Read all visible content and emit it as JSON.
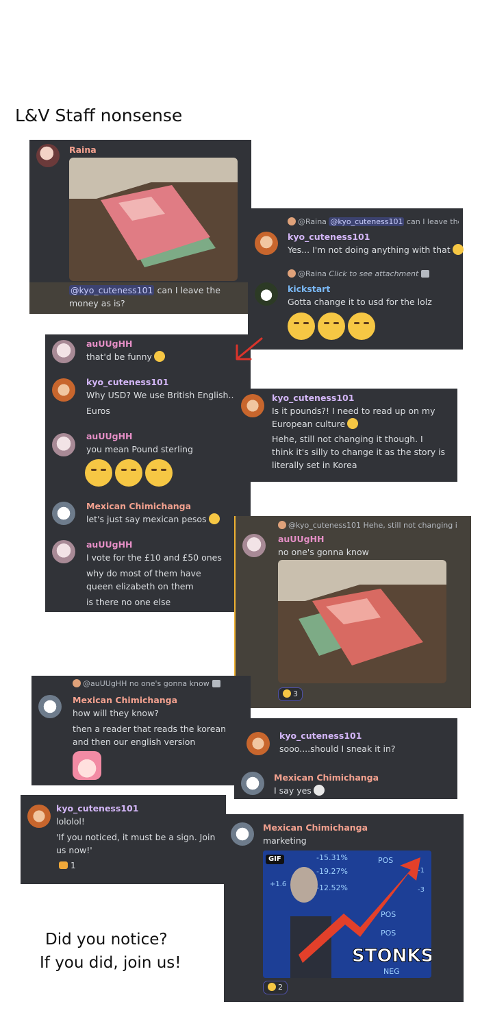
{
  "page": {
    "title": "L&V Staff nonsense",
    "closing_line_1": "Did you notice?",
    "closing_line_2": "If you did, join us!"
  },
  "colors": {
    "panel": "#313338",
    "highlight": "#45413a",
    "mention": "#3c4270",
    "accent_arrow": "#d9342b"
  },
  "card1": {
    "name": "Raina",
    "mention": "@kyo_cuteness101",
    "text": " can I leave the money as is?"
  },
  "card2": {
    "reply1_name": "@Raina",
    "reply1_mention": "@kyo_cuteness101",
    "reply1_text": " can I leave the m",
    "name1": "kyo_cuteness101",
    "text1": "Yes... I'm not doing anything with that",
    "reply2_name": "@Raina",
    "reply2_text": "Click to see attachment",
    "name2": "kickstart",
    "text2": "Gotta change it to usd for the lolz"
  },
  "card3": {
    "m1_name": "auUUgHH",
    "m1_text": "that'd be funny",
    "m2_name": "kyo_cuteness101",
    "m2_text1": "Why USD? We use British English...",
    "m2_text2": "Euros",
    "m3_name": "auUUgHH",
    "m3_text": "you mean Pound sterling",
    "m4_name": "Mexican Chimichanga",
    "m4_text": "let's just say mexican pesos",
    "m5_name": "auUUgHH",
    "m5_text1": "I vote for the £10 and £50 ones",
    "m5_text2": "why do most of them have queen elizabeth on them",
    "m5_text3": "is there no one else"
  },
  "card4": {
    "name": "kyo_cuteness101",
    "text1": "Is it pounds?! I need to read up on my European culture",
    "text2": "Hehe, still not changing it though. I think it's silly to change it as the story is literally set in Korea"
  },
  "card5": {
    "reply_name": "@kyo_cuteness101",
    "reply_text": "Hehe, still not changing i",
    "name": "auUUgHH",
    "text": "no one's gonna know",
    "reaction_count": "3"
  },
  "card6": {
    "reply_name": "@auUUgHH",
    "reply_text": "no one's gonna know",
    "name": "Mexican Chimichanga",
    "text1": "how will they know?",
    "text2": "then a reader that reads the korean and then our english version"
  },
  "card7": {
    "m1_name": "kyo_cuteness101",
    "m1_text": "sooo....should I sneak it in?",
    "m2_name": "Mexican Chimichanga",
    "m2_text": "I say yes"
  },
  "card8": {
    "name": "kyo_cuteness101",
    "text1": "lololol!",
    "text2": "'If you noticed, it must be a sign. Join us now!'",
    "reaction_count": "1"
  },
  "card9": {
    "name": "Mexican Chimichanga",
    "text": "marketing",
    "gif_badge": "GIF",
    "gif_caption": "STONKS",
    "reaction_count": "2",
    "ticker": [
      "-15.31%",
      "-19.27%",
      "-12.52%",
      "+1.6",
      "POS",
      "POS",
      "POS",
      "NEG",
      "-1",
      "-3"
    ]
  }
}
